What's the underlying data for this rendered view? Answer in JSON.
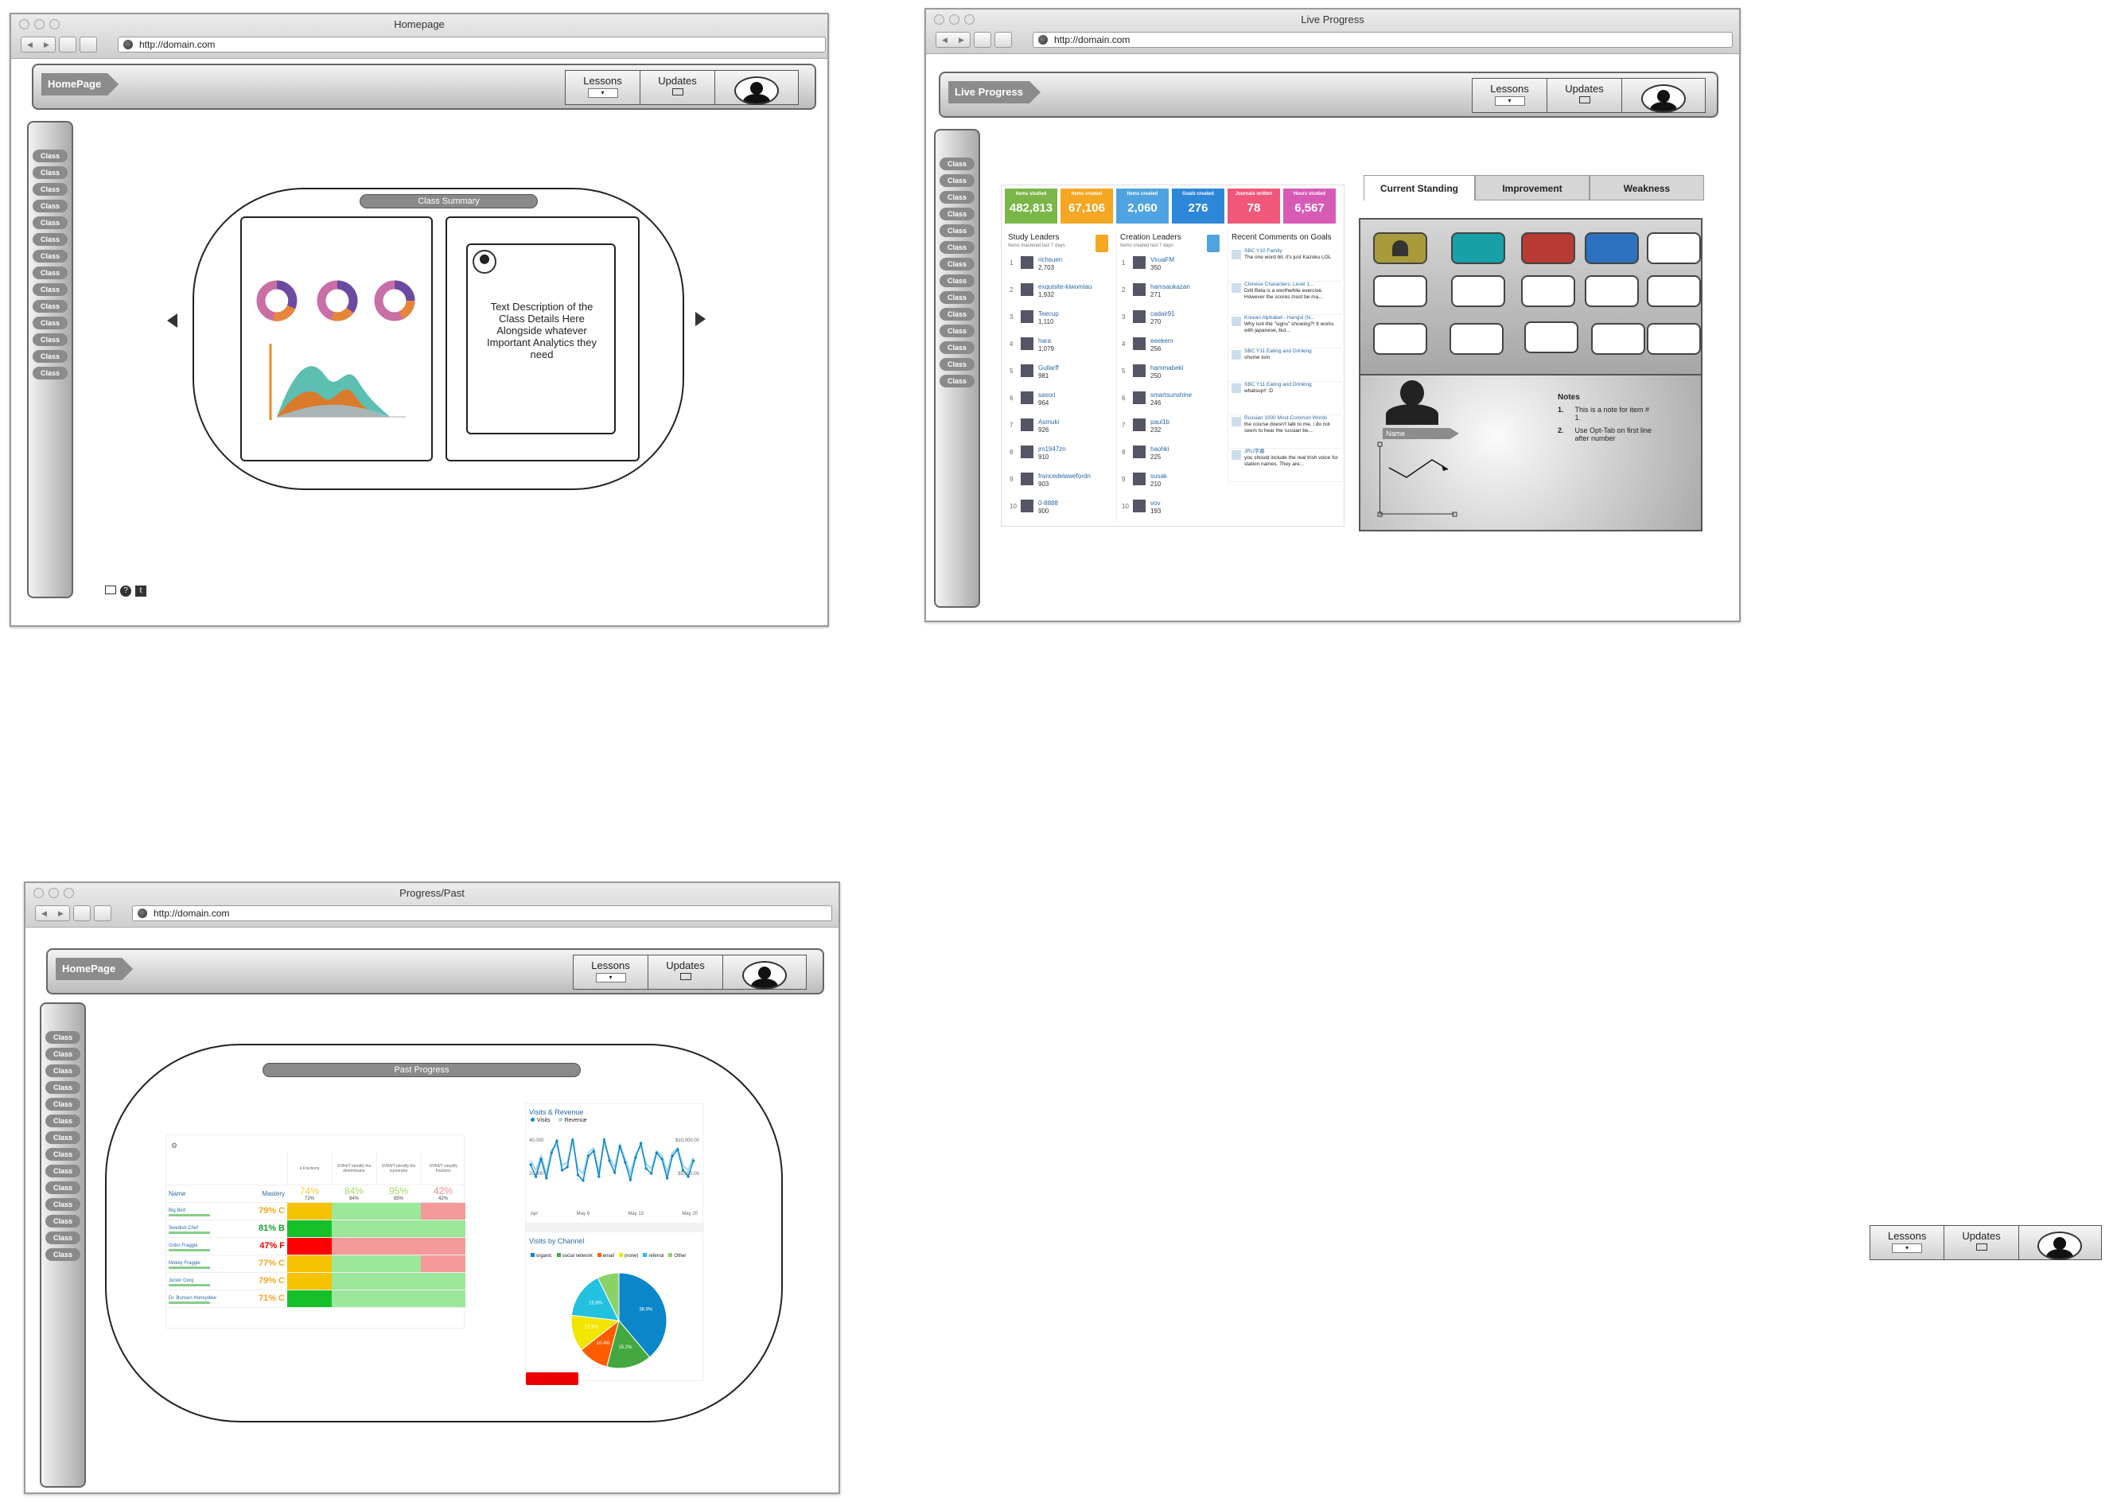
{
  "common": {
    "url": "http://domain.com",
    "nav": {
      "lessons": "Lessons",
      "updates": "Updates"
    },
    "class_label": "Class"
  },
  "homepage": {
    "window_title": "Homepage",
    "crumb": "HomePage",
    "summary_tag": "Class Summary",
    "description": "Text Description of the Class Details Here Alongside whatever Important Analytics they need"
  },
  "live": {
    "window_title": "Live Progress",
    "crumb": "Live Progress",
    "tiles": [
      {
        "label": "Items studied",
        "value": "482,813",
        "color": "#7ab648"
      },
      {
        "label": "Items created",
        "value": "67,106",
        "color": "#f5a623"
      },
      {
        "label": "Items created",
        "value": "2,060",
        "color": "#4fa3e0"
      },
      {
        "label": "Goals created",
        "value": "276",
        "color": "#2d87d8"
      },
      {
        "label": "Journals written",
        "value": "78",
        "color": "#f0587a"
      },
      {
        "label": "Hours studied",
        "value": "6,567",
        "color": "#d75ab5"
      }
    ],
    "study_title": "Study Leaders",
    "study_sub": "Items mastered last 7 days",
    "study": [
      {
        "rank": "1",
        "name": "richsuen",
        "score": "2,703"
      },
      {
        "rank": "2",
        "name": "exquisite-kiwomiau",
        "score": "1,932"
      },
      {
        "rank": "3",
        "name": "Teecup",
        "score": "1,110"
      },
      {
        "rank": "4",
        "name": "hara",
        "score": "1,079"
      },
      {
        "rank": "5",
        "name": "Gullarff",
        "score": "981"
      },
      {
        "rank": "6",
        "name": "sasori",
        "score": "964"
      },
      {
        "rank": "7",
        "name": "Asmuki",
        "score": "926"
      },
      {
        "rank": "8",
        "name": "jm1947zn",
        "score": "910"
      },
      {
        "rank": "9",
        "name": "francedelawefordn",
        "score": "903"
      },
      {
        "rank": "10",
        "name": "0-8888",
        "score": "900"
      }
    ],
    "creation_title": "Creation Leaders",
    "creation_sub": "Items created last 7 days",
    "creation": [
      {
        "rank": "1",
        "name": "ViruaFM",
        "score": "350"
      },
      {
        "rank": "2",
        "name": "hamsaukazan",
        "score": "271"
      },
      {
        "rank": "3",
        "name": "cadair91",
        "score": "270"
      },
      {
        "rank": "4",
        "name": "eeekem",
        "score": "256"
      },
      {
        "rank": "5",
        "name": "hammabeki",
        "score": "250"
      },
      {
        "rank": "6",
        "name": "smartsunshine",
        "score": "246"
      },
      {
        "rank": "7",
        "name": "paul1b",
        "score": "232"
      },
      {
        "rank": "8",
        "name": "haohki",
        "score": "225"
      },
      {
        "rank": "9",
        "name": "susak",
        "score": "210"
      },
      {
        "rank": "10",
        "name": "vov",
        "score": "193"
      }
    ],
    "comments_title": "Recent Comments on Goals",
    "comments": [
      {
        "title": "SBC Y10 Family",
        "text": "The one word bit, it's just Kazoku LOL"
      },
      {
        "title": "Chinese Characters: Level 1...",
        "text": "Drill Beta is a worthwhile exercise. However the scores must be ma..."
      },
      {
        "title": "Korean Alphabet - Hangul (N...",
        "text": "Why isnt the \"signs\" showing?! It works with japanese, but..."
      },
      {
        "title": "SBC Y11 Eating and Drinking",
        "text": "shome tom"
      },
      {
        "title": "SBC Y11 Eating and Drinking",
        "text": "whatsup!! :D"
      },
      {
        "title": "Russian 1000 Most Common Words",
        "text": "the course doesn't talk to me, i do not seem to hear the russian be..."
      },
      {
        "title": "JRU字幕",
        "text": "you should include the real trish voice for station names. They are..."
      }
    ],
    "tabs": [
      "Current Standing",
      "Improvement",
      "Weakness"
    ],
    "swatches": [
      "#a89a3a",
      "#17a0a8",
      "#b73a33",
      "#2c72c0"
    ],
    "name_tag": "Name",
    "notes_title": "Notes",
    "notes": [
      {
        "n": "1.",
        "text": "This is a note for item # 1."
      },
      {
        "n": "2.",
        "text": "Use Opt-Tab on first line after number"
      }
    ]
  },
  "past": {
    "window_title": "Progress/Past",
    "crumb": "HomePage",
    "tag": "Past Progress",
    "heat_headers": [
      "4 Fractions",
      "SVB4/T identify the denominator",
      "SVB4/T identify the numerator",
      "SVB4/T simplify fractions"
    ],
    "heat_name": "Name",
    "heat_mastery": "Mastery",
    "heat_avgs": [
      "74%",
      "84%",
      "95%",
      "42%"
    ],
    "heat_sub": [
      "72%",
      "84%",
      "85%",
      "42%"
    ],
    "students": [
      {
        "name": "Big Bird",
        "score": "79% C"
      },
      {
        "name": "Swedish Chef",
        "score": "81% B"
      },
      {
        "name": "Gobo Fraggle",
        "score": "47% F"
      },
      {
        "name": "Mokey Fraggle",
        "score": "77% C"
      },
      {
        "name": "Junior Gorg",
        "score": "79% C"
      },
      {
        "name": "Dr. Bunsen Honeydew",
        "score": "71% C"
      }
    ],
    "visits_title": "Visits & Revenue",
    "legend_visits": "Visits",
    "legend_revenue": "Revenue",
    "y_left_top": "40,000",
    "y_left_mid": "20,000",
    "y_right_top": "$10,000.00",
    "y_right_mid": "$5,000.00",
    "x_ticks": [
      "Apr",
      "May 6",
      "May 13",
      "May 20"
    ],
    "channel_title": "Visits by Channel",
    "channels": [
      "organic",
      "social network",
      "email",
      "(none)",
      "referral",
      "Other"
    ],
    "channel_colors": [
      "#0a86c9",
      "#43a83f",
      "#ff5c00",
      "#f2e600",
      "#22c1e0",
      "#8cd06a"
    ],
    "pie_values": [
      38.9,
      15.2,
      10.4,
      12.3,
      15.9,
      7.3
    ],
    "pie_labels": [
      "38.9%",
      "15.2%",
      "10.4%",
      "12.3%",
      "15.9%",
      ""
    ]
  }
}
